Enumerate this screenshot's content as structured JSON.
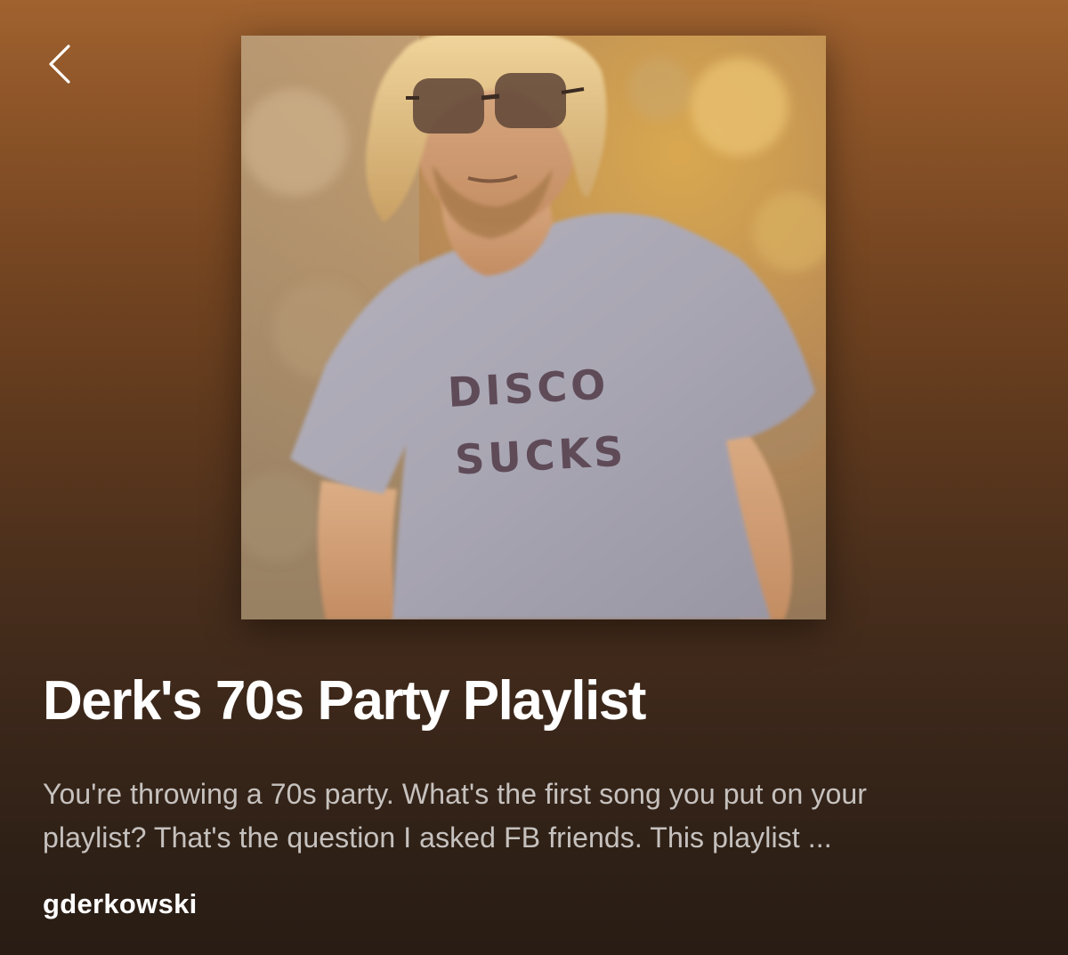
{
  "navigation": {
    "back_icon": "chevron-left-icon"
  },
  "cover": {
    "shirt_text_line1": "DISCO",
    "shirt_text_line2": "SUCKS"
  },
  "playlist": {
    "title": "Derk's 70s Party Playlist",
    "description_line1": "You're throwing a 70s party. What's the first song you put on your",
    "description_line2": "playlist? That's the question I asked FB friends. This playlist ...",
    "owner": "gderkowski"
  },
  "colors": {
    "gradient_top": "#a0622f",
    "gradient_bottom": "#281c14",
    "text_primary": "#ffffff",
    "text_secondary": "#c7bdb4"
  }
}
